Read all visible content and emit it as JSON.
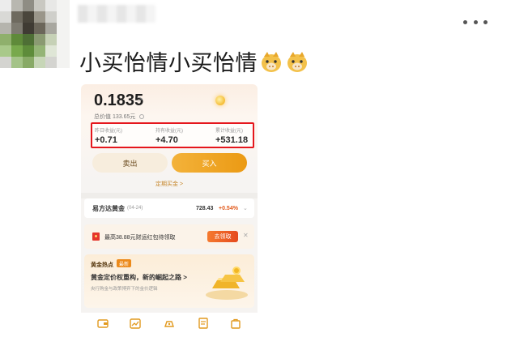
{
  "post": {
    "text": "小买怡情小买怡情",
    "emojis": [
      "pig-face-emoji",
      "pig-face-emoji"
    ]
  },
  "screenshot": {
    "price": "0.1835",
    "price_arrow": ">",
    "total_value_label": "总价值",
    "total_value": "133.65元",
    "stats": [
      {
        "label": "昨日收益(元)",
        "value": "+0.71"
      },
      {
        "label": "持有收益(元)",
        "value": "+4.70"
      },
      {
        "label": "累计收益(元)",
        "value": "+531.18"
      }
    ],
    "sell_label": "卖出",
    "buy_label": "买入",
    "auto_buy_label": "定期买金 >",
    "fund": {
      "name": "易方达黄金",
      "date": "(04-24)",
      "price": "728.43",
      "change": "+0.54%",
      "chevron": "⌄"
    },
    "promo": {
      "text": "最高38.88元财运红包待领取",
      "button": "去领取",
      "close": "✕"
    },
    "news": {
      "heading": "黄金热点",
      "badge": "最新",
      "title": "黄金定价权重构，新的崛起之路 >",
      "subtitle": "央行购金与政策博弈下的金价逻辑"
    },
    "tabs": [
      "wallet-icon",
      "chart-icon",
      "gold-bar-icon",
      "document-icon",
      "bag-icon"
    ]
  },
  "colors": {
    "highlight_border": "#e5161c",
    "buy_button": "#eb9a14",
    "positive": "#e25a1c"
  }
}
